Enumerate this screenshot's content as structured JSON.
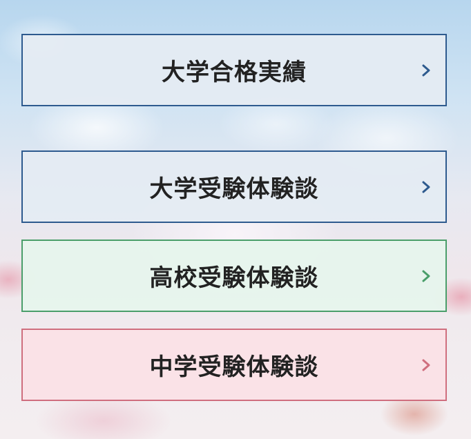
{
  "links": [
    {
      "label": "大学合格実績",
      "icon": "chevron-right-icon",
      "accent": "#2d5a8e"
    },
    {
      "label": "大学受験体験談",
      "icon": "chevron-right-icon",
      "accent": "#2d5a8e"
    },
    {
      "label": "高校受験体験談",
      "icon": "chevron-right-icon",
      "accent": "#4a9e6a"
    },
    {
      "label": "中学受験体験談",
      "icon": "chevron-right-icon",
      "accent": "#cf6e7e"
    }
  ]
}
